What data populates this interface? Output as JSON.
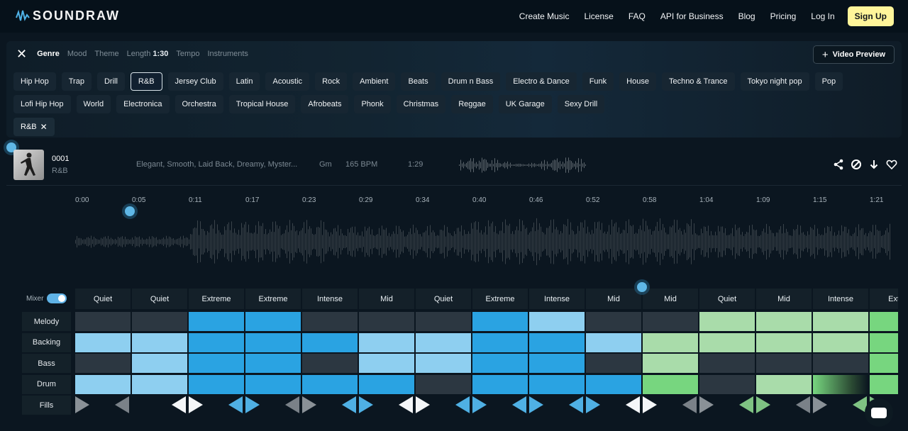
{
  "brand": {
    "name": "SOUNDRAW"
  },
  "nav": {
    "links": [
      "Create Music",
      "License",
      "FAQ",
      "API for Business",
      "Blog",
      "Pricing",
      "Log In"
    ],
    "signup": "Sign Up"
  },
  "filters": {
    "tabs": [
      {
        "label": "Genre",
        "active": true
      },
      {
        "label": "Mood",
        "active": false
      },
      {
        "label": "Theme",
        "active": false
      },
      {
        "label": "Length",
        "value": "1:30",
        "active": false
      },
      {
        "label": "Tempo",
        "active": false
      },
      {
        "label": "Instruments",
        "active": false
      }
    ],
    "video_preview": "Video Preview",
    "genres_row1": [
      "Hip Hop",
      "Trap",
      "Drill",
      "R&B",
      "Jersey Club",
      "Latin",
      "Acoustic",
      "Rock",
      "Ambient",
      "Beats",
      "Drum n Bass",
      "Electro & Dance",
      "Funk",
      "House",
      "Techno & Trance",
      "Tokyo night pop",
      "Pop"
    ],
    "genres_row2": [
      "Lofi Hip Hop",
      "World",
      "Electronica",
      "Orchestra",
      "Tropical House",
      "Afrobeats",
      "Phonk",
      "Christmas",
      "Reggae",
      "UK Garage",
      "Sexy Drill"
    ],
    "selected_genre": "R&B",
    "selected_chip": "R&B"
  },
  "track": {
    "number": "0001",
    "genre": "R&B",
    "moods": "Elegant, Smooth, Laid Back, Dreamy, Myster...",
    "key": "Gm",
    "bpm": "165 BPM",
    "length": "1:29",
    "actions": [
      "share-icon",
      "block-icon",
      "download-icon",
      "heart-icon"
    ]
  },
  "timeline": {
    "ticks": [
      "0:00",
      "0:05",
      "0:11",
      "0:17",
      "0:23",
      "0:29",
      "0:34",
      "0:40",
      "0:46",
      "0:52",
      "0:58",
      "1:04",
      "1:09",
      "1:15",
      "1:21"
    ]
  },
  "mixer": {
    "label": "Mixer",
    "enabled": true,
    "rows": [
      "Melody",
      "Backing",
      "Bass",
      "Drum",
      "Fills"
    ],
    "intensities": [
      "Quiet",
      "Quiet",
      "Extreme",
      "Extreme",
      "Intense",
      "Mid",
      "Quiet",
      "Extreme",
      "Intense",
      "Mid",
      "Mid",
      "Quiet",
      "Mid",
      "Intense",
      "Extre"
    ],
    "colors": {
      "off": "#2c3741",
      "light": "#8ecff0",
      "strong": "#2aa3e2",
      "green_light": "#a9dcaa",
      "green_strong": "#77d67f"
    },
    "cells": {
      "Melody": [
        "off",
        "off",
        "strong",
        "strong",
        "off",
        "off",
        "off",
        "strong",
        "light",
        "off",
        "off",
        "green_light",
        "green_light",
        "green_light",
        "green_strong"
      ],
      "Backing": [
        "light",
        "light",
        "strong",
        "strong",
        "strong",
        "light",
        "light",
        "strong",
        "strong",
        "light",
        "green_light",
        "green_light",
        "green_light",
        "green_light",
        "green_strong"
      ],
      "Bass": [
        "off",
        "light",
        "strong",
        "strong",
        "off",
        "light",
        "light",
        "strong",
        "strong",
        "off",
        "green_light",
        "off",
        "off",
        "off",
        "green_strong"
      ],
      "Drum": [
        "light",
        "light",
        "strong",
        "strong",
        "strong",
        "strong",
        "off",
        "strong",
        "strong",
        "strong",
        "green_strong",
        "off",
        "green_light",
        "green_fade",
        "green_strong"
      ]
    },
    "fills": [
      "gray",
      "white",
      "blue",
      "gray",
      "blue",
      "white",
      "blue",
      "blue",
      "blue",
      "white",
      "gray",
      "green",
      "gray",
      "green",
      "green"
    ]
  }
}
